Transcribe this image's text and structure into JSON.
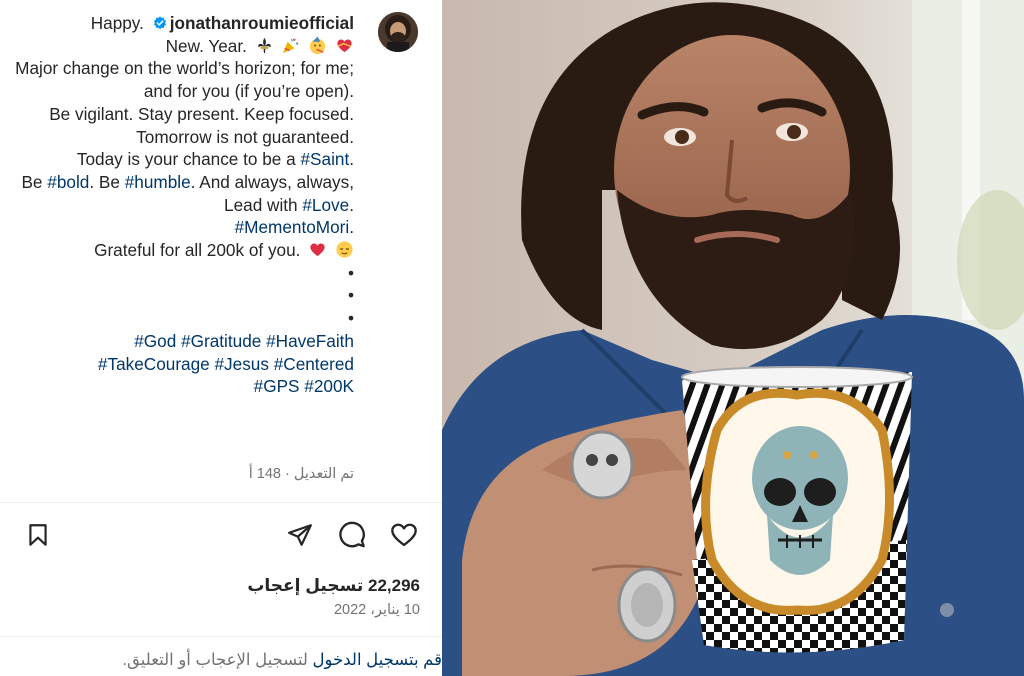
{
  "post": {
    "username": "jonathanroumieofficial",
    "caption": {
      "line1_word": "Happy.",
      "line2": "New. Year.",
      "line3": "Major change on the world’s horizon; for me; and for you (if you’re open).",
      "line4": "Be vigilant. Stay present. Keep focused.",
      "line5": "Tomorrow is not guaranteed.",
      "line6_text": "Today is your chance to be a",
      "line6_tag": "#Saint",
      "line6_end": ".",
      "line7_a": "Be",
      "tag_bold": "#bold",
      "line7_b": ". Be",
      "tag_humble": "#humble",
      "line7_c": ". And always, always, Lead with",
      "tag_love": "#Love",
      "line7_d": ".",
      "tag_memento": "#MementoMori",
      "line8_end": ".",
      "line9": "Grateful for all 200k of you.",
      "dot1": "•",
      "dot2": "•",
      "dot3": "•",
      "hashtags_line1": "#God #Gratitude #HaveFaith",
      "hashtags_line2": "#TakeCourage #Jesus #Centered",
      "hashtags_line3": "#GPS #200K"
    },
    "edited_label": "تم التعديل · 148 أ",
    "likes_text": "22,296 تسجيل إعجاب",
    "date_text": "10 يناير، 2022",
    "login_link": "قم بتسجيل الدخول",
    "login_rest": " لتسجيل الإعجاب أو التعليق."
  },
  "icons": {
    "save": "bookmark-icon",
    "share": "send-icon",
    "comment": "comment-icon",
    "like": "heart-icon",
    "verified": "verified-badge-icon"
  },
  "colors": {
    "hashtag": "#00376b",
    "verified": "#0095f6",
    "muted": "#737373",
    "text": "#262626"
  }
}
